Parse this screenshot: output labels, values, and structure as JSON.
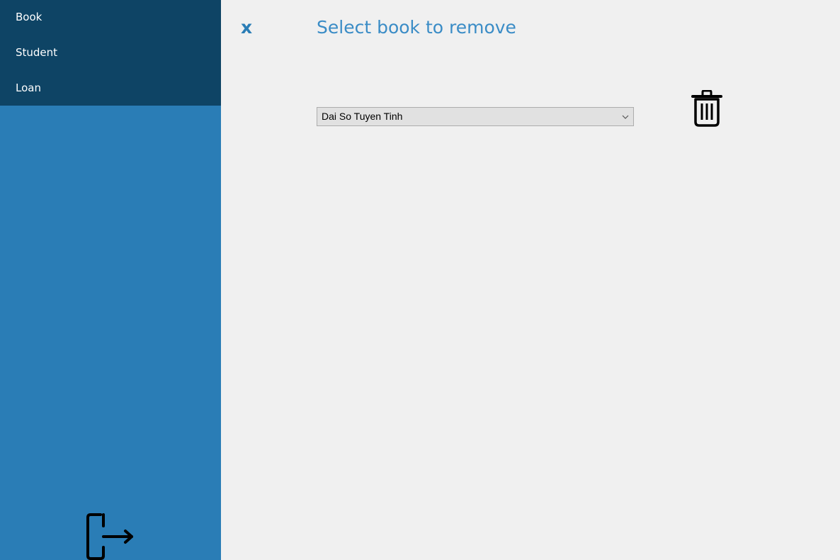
{
  "sidebar": {
    "menu": [
      {
        "label": "Book"
      },
      {
        "label": "Student"
      },
      {
        "label": "Loan"
      }
    ],
    "logout_icon": "logout-icon"
  },
  "header": {
    "close_label": "x",
    "title": "Select book to remove"
  },
  "form": {
    "book_select": {
      "selected": "Dai So Tuyen Tinh"
    },
    "delete_icon": "trash-icon"
  },
  "colors": {
    "menu_background": "#0e4465",
    "sidebar_background": "#2a7db6",
    "accent": "#3a8cc6",
    "content_background": "#f0f0f0"
  }
}
